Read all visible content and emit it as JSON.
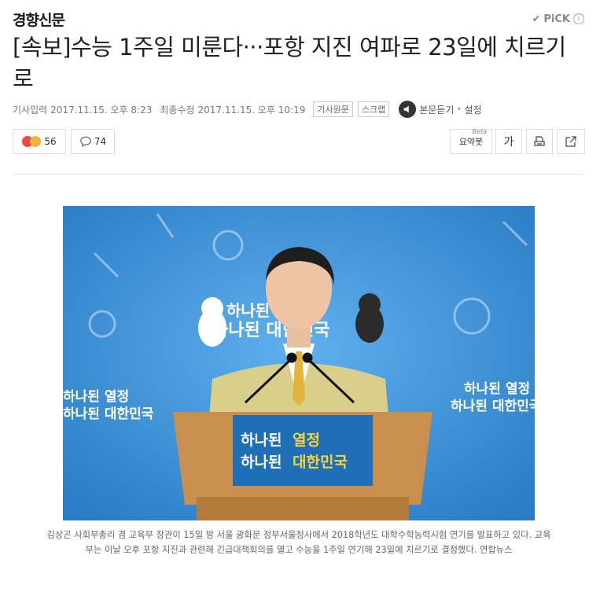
{
  "header": {
    "press_name": "경향신문",
    "pick_label": "PiCK",
    "pick_check_icon": "check-icon",
    "info_icon": "info-icon"
  },
  "article": {
    "headline": "[속보]수능 1주일 미룬다···포항 지진 여파로 23일에 치르기로",
    "meta": {
      "input_label": "기사입력",
      "input_time": "2017.11.15. 오후 8:23",
      "modified_label": "최종수정",
      "modified_time": "2017.11.15. 오후 10:19",
      "original_button": "기사원문",
      "scrap_button": "스크랩",
      "listen_button": "본문듣기",
      "separator": "•",
      "settings_button": "설정"
    },
    "actions": {
      "reaction_count": "56",
      "comment_count": "74",
      "summary_label": "요약봇",
      "summary_beta": "Beta",
      "font_size_label": "가",
      "print_icon": "print-icon",
      "share_icon": "share-icon"
    },
    "photo": {
      "backdrop_text_left": "하나된 열정\n하나된 대한민국",
      "backdrop_line1": "하나된 열정",
      "backdrop_line2": "하나된 대한민국",
      "podium_line1a": "하나된 ",
      "podium_line1b": "열정",
      "podium_line2a": "하나된 ",
      "podium_line2b": "대한민국",
      "colors": {
        "backdrop": "#3b8fd3",
        "podium": "#c98f4e",
        "jacket": "#d9cf8a",
        "podium_accent": "#f5d43a"
      }
    },
    "caption": "김상곤 사회부총리 겸 교육부 장관이 15일 밤 서울 광화문 정부서울청사에서 2018학년도 대학수학능력시험 연기를 발표하고 있다. 교육부는 이날 오후 포항 지진과 관련해 긴급대책회의를 열고 수능을 1주일 연기해 23일에 치르기로 결정했다. 연합뉴스"
  }
}
